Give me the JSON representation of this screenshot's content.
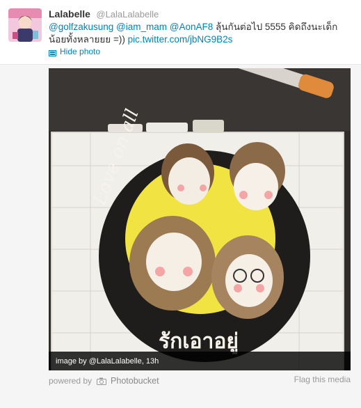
{
  "tweet": {
    "fullname": "Lalabelle",
    "username": "@LalaLalabelle",
    "mentions": [
      "@golfzakusung",
      "@iam_mam",
      "@AonAF8"
    ],
    "text_after_mentions": "ลุ้นกันต่อไป 5555 คิดถึงนะเด็กน้อยทั้งหลายยย =))",
    "link": "pic.twitter.com/jbNG9B2s",
    "hide_photo_label": "Hide photo"
  },
  "media": {
    "caption_prefix": "image by",
    "caption_user": "@LalaLalabelle",
    "caption_time": "13h",
    "powered_by_label": "powered by",
    "provider": "Photobucket",
    "flag_label": "Flag this media",
    "artwork_text": {
      "bottom_thai": "รักเอาอยู่",
      "side_left": "Love on all"
    }
  },
  "colors": {
    "link": "#0084b4",
    "muted": "#999999",
    "circle_yellow": "#f1e342"
  }
}
